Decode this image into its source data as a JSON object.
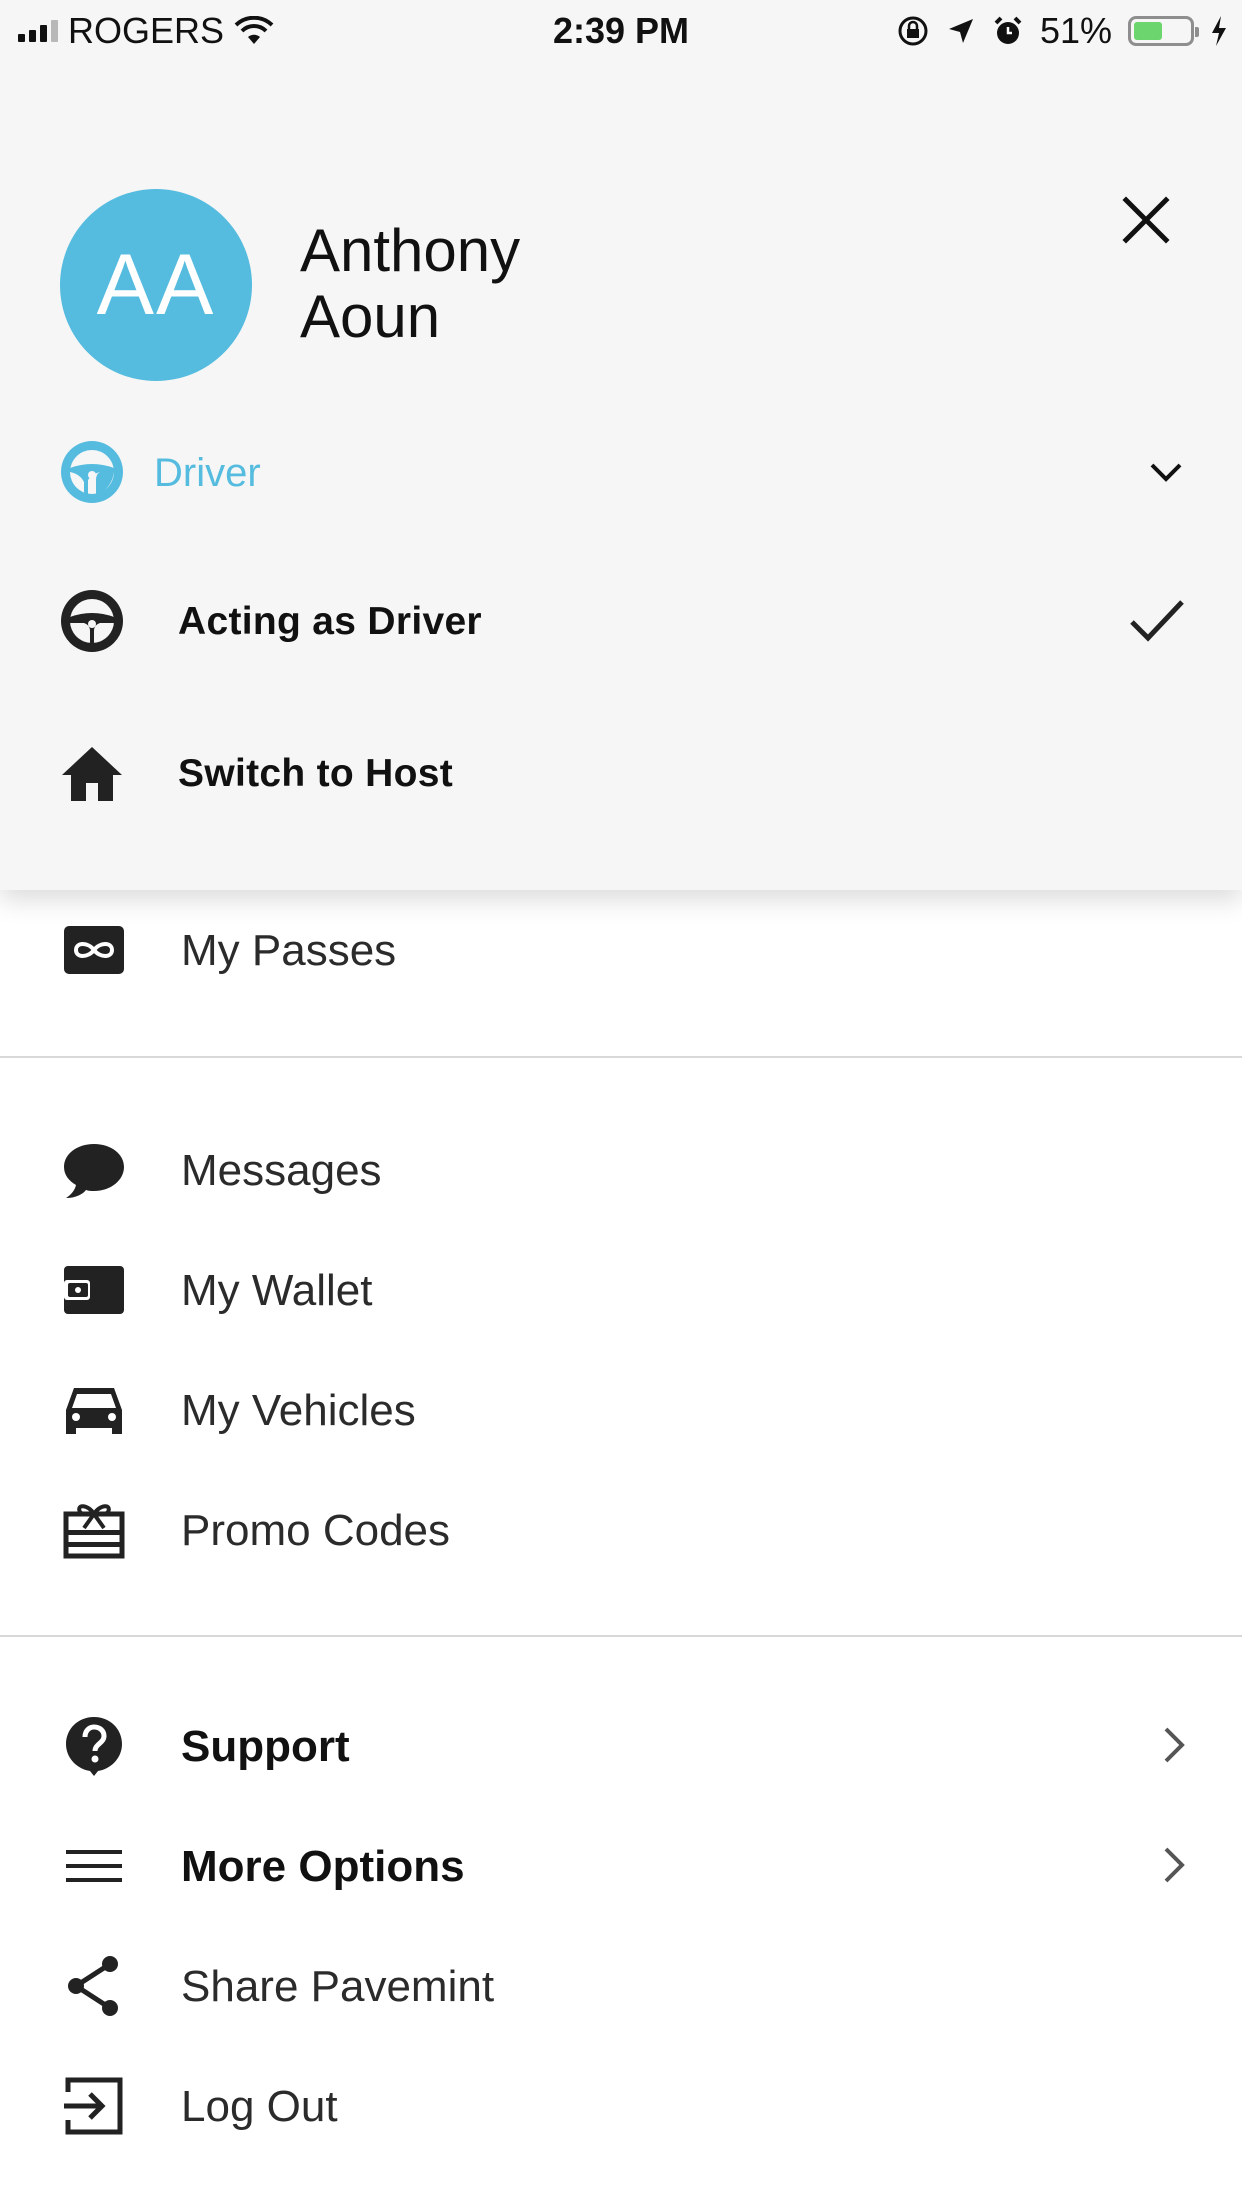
{
  "status_bar": {
    "carrier": "ROGERS",
    "time": "2:39 PM",
    "battery_percent_text": "51%",
    "battery_level": 0.51,
    "icons": [
      "signal-icon",
      "wifi-icon",
      "orientation-lock-icon",
      "location-arrow-icon",
      "alarm-icon",
      "battery-icon",
      "charging-bolt-icon"
    ]
  },
  "profile": {
    "initials": "AA",
    "first_name": "Anthony",
    "last_name": "Aoun",
    "avatar_color": "#55bcdf"
  },
  "role_selector": {
    "current_role": "Driver",
    "accent_color": "#55bcdf"
  },
  "role_options": [
    {
      "label": "Acting as Driver",
      "icon": "steering-wheel-icon",
      "selected": true
    },
    {
      "label": "Switch to Host",
      "icon": "home-icon",
      "selected": false
    }
  ],
  "menu": {
    "passes": "My Passes",
    "messages": "Messages",
    "wallet": "My Wallet",
    "vehicles": "My Vehicles",
    "promo_codes": "Promo Codes",
    "support": "Support",
    "more_options": "More Options",
    "share": "Share Pavemint",
    "log_out": "Log Out"
  }
}
